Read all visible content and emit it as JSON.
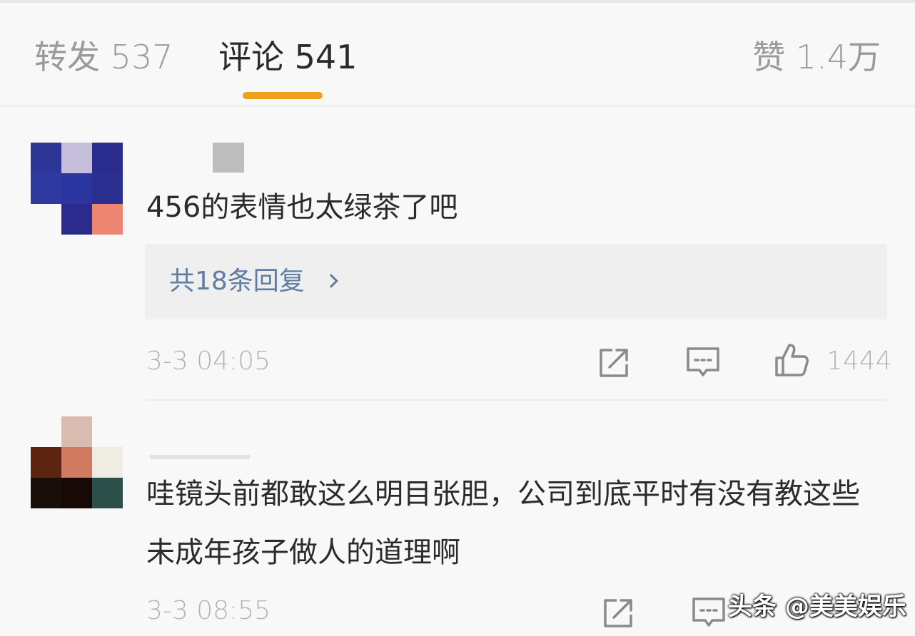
{
  "tabs": {
    "reposts": "转发 537",
    "comments": "评论 541",
    "likes": "赞 1.4万"
  },
  "accent_color": "#f0a11e",
  "link_color": "#5f7ea1",
  "comments": [
    {
      "text": "456的表情也太绿茶了吧",
      "replies_label": "共18条回复",
      "timestamp": "3-3 04:05",
      "like_count": "1444",
      "avatar": "pixelated"
    },
    {
      "text": "哇镜头前都敢这么明目张胆，公司到底平时有没有教这些未成年孩子做人的道理啊",
      "timestamp": "3-3 08:55",
      "avatar": "pixelated"
    }
  ],
  "icons": [
    "share-icon",
    "comment-icon",
    "thumbs-up-icon"
  ],
  "watermark": "头条 @美美娱乐"
}
